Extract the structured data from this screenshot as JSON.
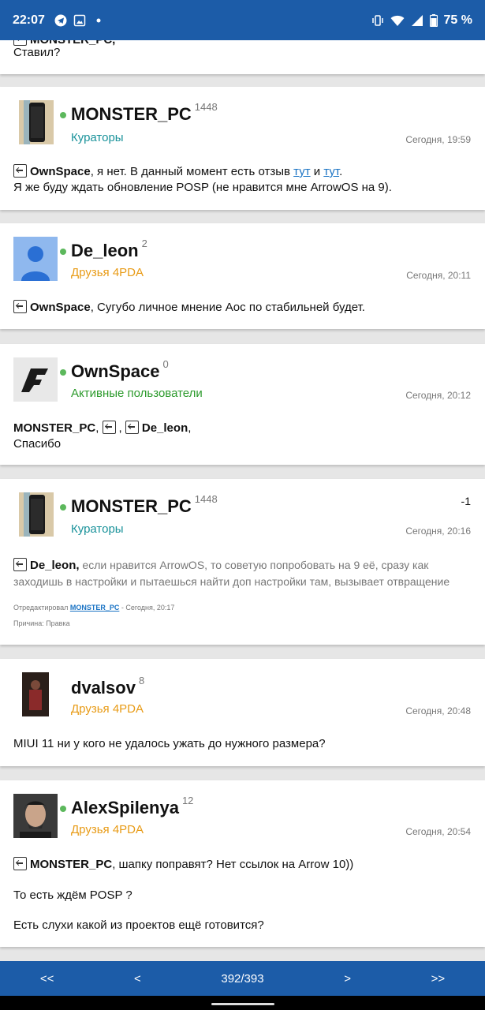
{
  "status_bar": {
    "time": "22:07",
    "battery": "75 %",
    "icons": [
      "telegram-icon",
      "image-icon",
      "dot-icon",
      "vibrate-icon",
      "wifi-icon",
      "signal-icon",
      "battery-icon"
    ]
  },
  "top_partial": {
    "name_fragment": "MONSTER_PC,",
    "text": "Ставил?"
  },
  "posts": [
    {
      "author": "MONSTER_PC",
      "reputation": "1448",
      "group": "Кураторы",
      "date": "Сегодня, 19:59",
      "quote_user": "OwnSpace",
      "text_a": ", я нет. В данный момент есть отзыв ",
      "link1": "тут",
      "text_b": " и ",
      "link2": "тут",
      "text_c": ".",
      "line2": "Я же буду ждать обновление POSP (не нравится мне ArrowOS на 9)."
    },
    {
      "author": "De_leon",
      "reputation": "2",
      "group": "Друзья 4PDA",
      "date": "Сегодня, 20:11",
      "quote_user": "OwnSpace",
      "text": ",  Сугубо личное мнение Аос по стабильней будет."
    },
    {
      "author": "OwnSpace",
      "reputation": "0",
      "group": "Активные пользователи",
      "date": "Сегодня, 20:12",
      "mention1": "MONSTER_PC",
      "mention2": "De_leon",
      "sep": ",",
      "line2": "Спасибо"
    },
    {
      "author": "MONSTER_PC",
      "reputation": "1448",
      "group": "Кураторы",
      "date": "Сегодня, 20:16",
      "vote": "-1",
      "quote_user": "De_leon,",
      "text": " если нравится ArrowOS, то советую попробовать на 9 её, сразу как заходишь в настройки и пытаешься найти доп настройки там, вызывает отвращение",
      "edited_label": "Отредактировал ",
      "edited_user": "MONSTER_PC",
      "edited_date": " - Сегодня, 20:17",
      "reason": "Причина: Правка"
    },
    {
      "author": "dvalsov",
      "reputation": "8",
      "group": "Друзья 4PDA",
      "date": "Сегодня, 20:48",
      "text": "MIUI 11 ни у кого не удалось ужать до нужного размера?"
    },
    {
      "author": "AlexSpilenya",
      "reputation": "12",
      "group": "Друзья 4PDA",
      "date": "Сегодня, 20:54",
      "quote_user": "MONSTER_PC",
      "text": ", шапку поправят? Нет ссылок на Arrow 10))",
      "line2": "То есть ждём POSP ?",
      "line3": "Есть слухи какой из проектов ещё готовится?"
    }
  ],
  "pager": {
    "first": "<<",
    "prev": "<",
    "page": "392/393",
    "next": ">",
    "last": ">>"
  }
}
